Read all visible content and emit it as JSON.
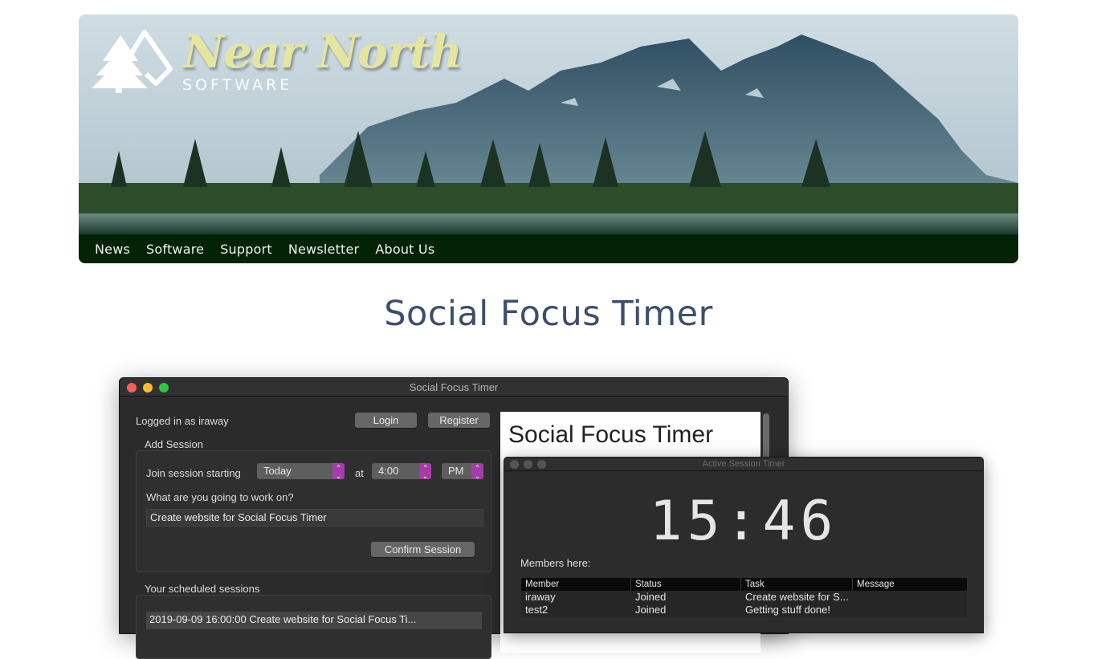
{
  "site": {
    "brand_name": "Near North",
    "brand_sub": "SOFTWARE",
    "nav": [
      "News",
      "Software",
      "Support",
      "Newsletter",
      "About Us"
    ]
  },
  "page": {
    "title": "Social Focus Timer"
  },
  "main_window": {
    "title": "Social Focus Timer",
    "logged_in_text": "Logged in as iraway",
    "login_label": "Login",
    "register_label": "Register",
    "add_session_label": "Add Session",
    "join_label": "Join session starting",
    "day_select": "Today",
    "at_label": "at",
    "time_select": "4:00",
    "ampm_select": "PM",
    "work_question": "What are you going to work on?",
    "task_value": "Create website for Social Focus Timer",
    "confirm_label": "Confirm Session",
    "scheduled_label": "Your scheduled sessions",
    "scheduled_items": [
      "2019-09-09 16:00:00  Create website for Social Focus Ti..."
    ],
    "webview_heading": "Social Focus Timer"
  },
  "timer_window": {
    "title": "Active Session Timer",
    "time": "15:46",
    "members_label": "Members here:",
    "columns": [
      "Member",
      "Status",
      "Task",
      "Message"
    ],
    "rows": [
      [
        "iraway",
        "Joined",
        "Create website for S...",
        ""
      ],
      [
        "test2",
        "Joined",
        "Getting stuff done!",
        ""
      ]
    ]
  }
}
